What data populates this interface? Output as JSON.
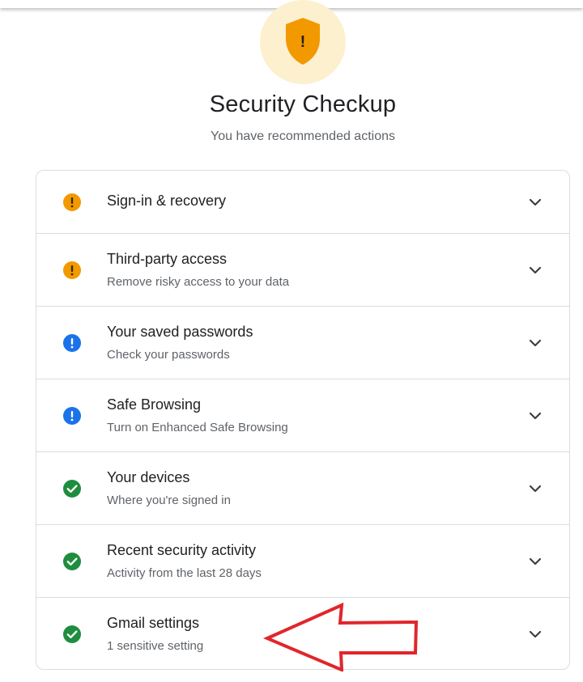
{
  "header": {
    "title": "Security Checkup",
    "subtitle": "You have recommended actions",
    "hero_icon": "shield-warning-icon",
    "hero_glyph": "!"
  },
  "colors": {
    "warning": "#f29900",
    "info": "#1a73e8",
    "ok": "#1e8e3e",
    "annotation": "#e0262b"
  },
  "items": [
    {
      "title": "Sign-in & recovery",
      "subtitle": "",
      "status": "warning"
    },
    {
      "title": "Third-party access",
      "subtitle": "Remove risky access to your data",
      "status": "warning"
    },
    {
      "title": "Your saved passwords",
      "subtitle": "Check your passwords",
      "status": "info"
    },
    {
      "title": "Safe Browsing",
      "subtitle": "Turn on Enhanced Safe Browsing",
      "status": "info"
    },
    {
      "title": "Your devices",
      "subtitle": "Where you're signed in",
      "status": "ok"
    },
    {
      "title": "Recent security activity",
      "subtitle": "Activity from the last 28 days",
      "status": "ok"
    },
    {
      "title": "Gmail settings",
      "subtitle": "1 sensitive setting",
      "status": "ok"
    }
  ],
  "annotation": {
    "type": "arrow-outline",
    "points_to": "Gmail settings"
  }
}
